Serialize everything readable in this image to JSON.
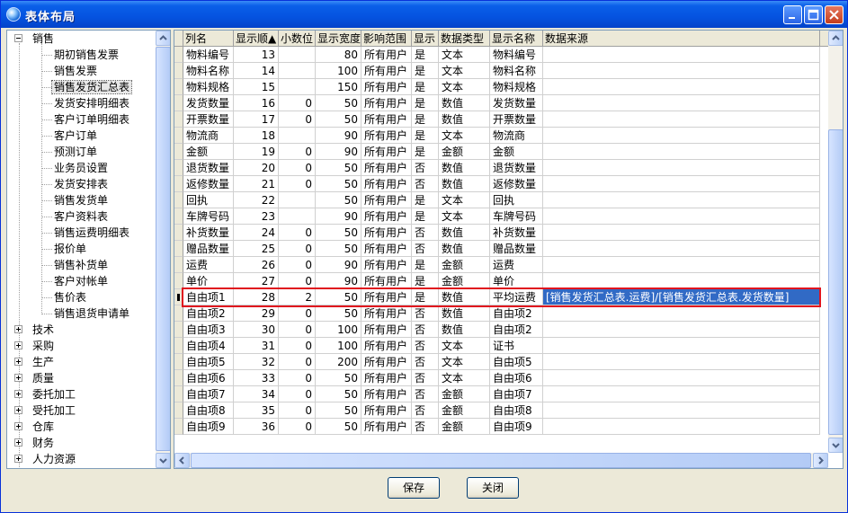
{
  "window": {
    "title": "表体布局"
  },
  "tree": {
    "root": "销售",
    "children": [
      "期初销售发票",
      "销售发票",
      "销售发货汇总表",
      "发货安排明细表",
      "客户订单明细表",
      "客户订单",
      "预测订单",
      "业务员设置",
      "发货安排表",
      "销售发货单",
      "客户资料表",
      "销售运费明细表",
      "报价单",
      "销售补货单",
      "客户对帐单",
      "售价表",
      "销售退货申请单"
    ],
    "selected_index": 2,
    "collapsed": [
      "技术",
      "采购",
      "生产",
      "质量",
      "委托加工",
      "受托加工",
      "仓库",
      "财务",
      "人力资源"
    ]
  },
  "grid": {
    "headers": [
      "列名",
      "显示顺▲",
      "小数位",
      "显示宽度",
      "影响范围",
      "显示",
      "数据类型",
      "显示名称",
      "数据来源"
    ],
    "rows": [
      [
        "物料编号",
        "13",
        "",
        "80",
        "所有用户",
        "是",
        "文本",
        "物料编号",
        ""
      ],
      [
        "物料名称",
        "14",
        "",
        "100",
        "所有用户",
        "是",
        "文本",
        "物料名称",
        ""
      ],
      [
        "物料规格",
        "15",
        "",
        "150",
        "所有用户",
        "是",
        "文本",
        "物料规格",
        ""
      ],
      [
        "发货数量",
        "16",
        "0",
        "50",
        "所有用户",
        "是",
        "数值",
        "发货数量",
        ""
      ],
      [
        "开票数量",
        "17",
        "0",
        "50",
        "所有用户",
        "是",
        "数值",
        "开票数量",
        ""
      ],
      [
        "物流商",
        "18",
        "",
        "90",
        "所有用户",
        "是",
        "文本",
        "物流商",
        ""
      ],
      [
        "金额",
        "19",
        "0",
        "90",
        "所有用户",
        "是",
        "金额",
        "金额",
        ""
      ],
      [
        "退货数量",
        "20",
        "0",
        "50",
        "所有用户",
        "否",
        "数值",
        "退货数量",
        ""
      ],
      [
        "返修数量",
        "21",
        "0",
        "50",
        "所有用户",
        "否",
        "数值",
        "返修数量",
        ""
      ],
      [
        "回执",
        "22",
        "",
        "50",
        "所有用户",
        "是",
        "文本",
        "回执",
        ""
      ],
      [
        "车牌号码",
        "23",
        "",
        "90",
        "所有用户",
        "是",
        "文本",
        "车牌号码",
        ""
      ],
      [
        "补货数量",
        "24",
        "0",
        "50",
        "所有用户",
        "否",
        "数值",
        "补货数量",
        ""
      ],
      [
        "赠品数量",
        "25",
        "0",
        "50",
        "所有用户",
        "否",
        "数值",
        "赠品数量",
        ""
      ],
      [
        "运费",
        "26",
        "0",
        "90",
        "所有用户",
        "是",
        "金额",
        "运费",
        ""
      ],
      [
        "单价",
        "27",
        "0",
        "90",
        "所有用户",
        "是",
        "金额",
        "单价",
        ""
      ],
      [
        "自由项1",
        "28",
        "2",
        "50",
        "所有用户",
        "是",
        "数值",
        "平均运费",
        "[销售发货汇总表.运费]/[销售发货汇总表.发货数量]"
      ],
      [
        "自由项2",
        "29",
        "0",
        "50",
        "所有用户",
        "否",
        "数值",
        "自由项2",
        ""
      ],
      [
        "自由项3",
        "30",
        "0",
        "100",
        "所有用户",
        "否",
        "数值",
        "自由项2",
        ""
      ],
      [
        "自由项4",
        "31",
        "0",
        "100",
        "所有用户",
        "否",
        "文本",
        "证书",
        ""
      ],
      [
        "自由项5",
        "32",
        "0",
        "200",
        "所有用户",
        "否",
        "文本",
        "自由项5",
        ""
      ],
      [
        "自由项6",
        "33",
        "0",
        "50",
        "所有用户",
        "否",
        "文本",
        "自由项6",
        ""
      ],
      [
        "自由项7",
        "34",
        "0",
        "50",
        "所有用户",
        "否",
        "金额",
        "自由项7",
        ""
      ],
      [
        "自由项8",
        "35",
        "0",
        "50",
        "所有用户",
        "否",
        "金额",
        "自由项8",
        ""
      ],
      [
        "自由项9",
        "36",
        "0",
        "50",
        "所有用户",
        "否",
        "金额",
        "自由项9",
        ""
      ]
    ],
    "current_row": 15
  },
  "buttons": {
    "save": "保存",
    "close": "关闭"
  }
}
